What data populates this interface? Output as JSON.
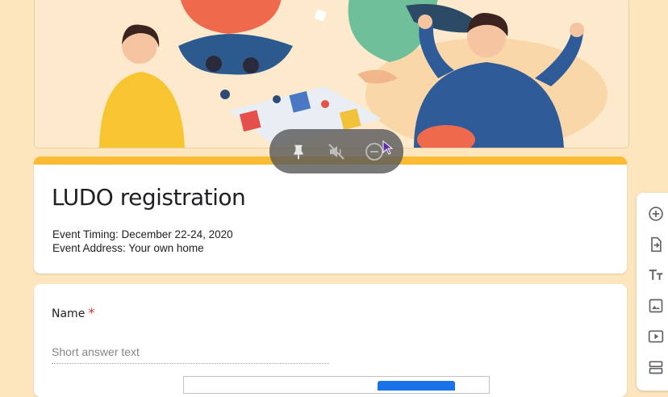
{
  "pip_controls": {
    "icons": [
      "pin-icon",
      "mute-icon",
      "minus-circle-icon"
    ]
  },
  "form": {
    "title": "LUDO registration",
    "description_lines": [
      "Event Timing: December 22-24, 2020",
      "Event Address: Your own home"
    ],
    "accent_color": "#fbbc34"
  },
  "question": {
    "label": "Name",
    "required_mark": "*",
    "placeholder": "Short answer text"
  },
  "toolbar": {
    "icons": [
      "add-question-icon",
      "import-questions-icon",
      "add-title-icon",
      "add-image-icon",
      "add-video-icon",
      "add-section-icon"
    ]
  },
  "colors": {
    "background": "#fde5bd",
    "primary_blue": "#1a73e8",
    "required_red": "#d93025"
  }
}
